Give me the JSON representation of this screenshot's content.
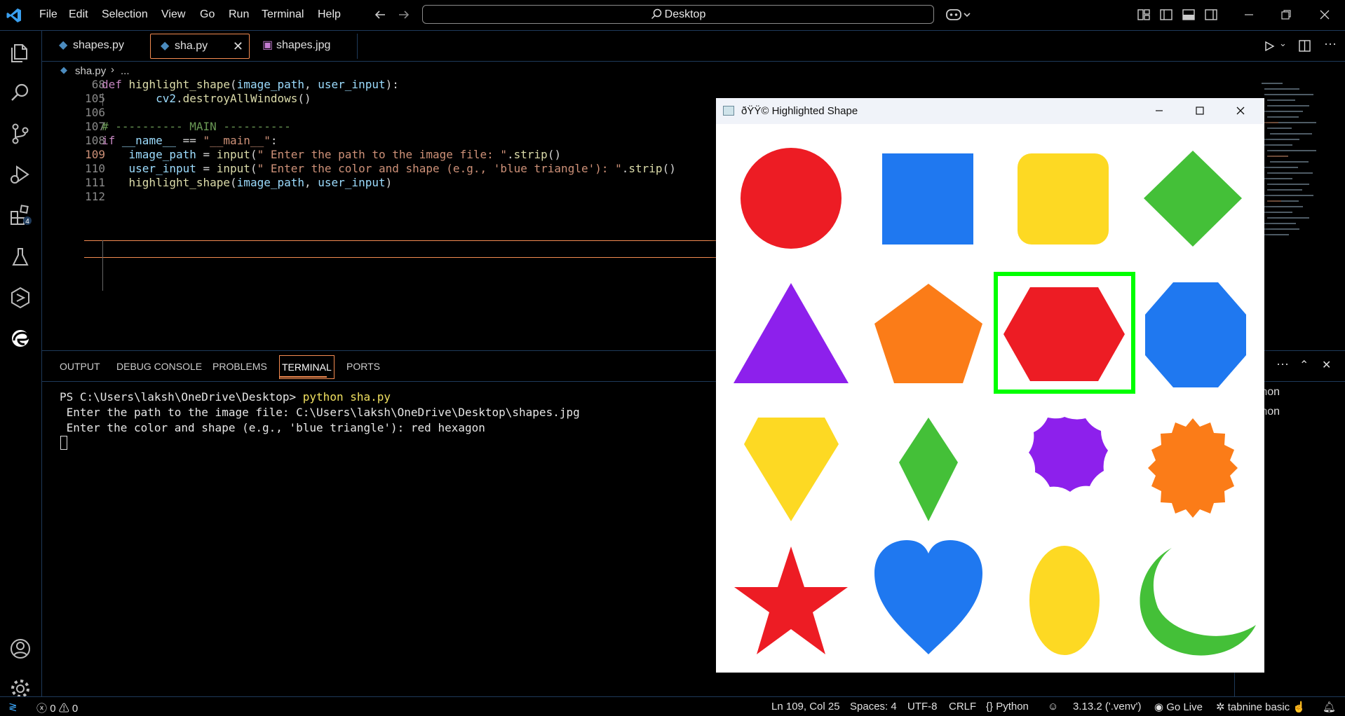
{
  "titlebar": {
    "menu": [
      "File",
      "Edit",
      "Selection",
      "View",
      "Go",
      "Run",
      "Terminal",
      "Help"
    ],
    "search_text": "Desktop"
  },
  "tabs": [
    {
      "label": "shapes.py",
      "icon": "python-file-icon"
    },
    {
      "label": "sha.py",
      "icon": "python-file-icon",
      "active": true
    },
    {
      "label": "shapes.jpg",
      "icon": "image-file-icon"
    }
  ],
  "breadcrumb": {
    "file": "sha.py",
    "rest": "..."
  },
  "editor": {
    "lines": [
      {
        "num": "68",
        "parts": [
          [
            "kw",
            "def "
          ],
          [
            "fn",
            "highlight_shape"
          ],
          [
            "pl",
            "("
          ],
          [
            "var",
            "image_path"
          ],
          [
            "pl",
            ", "
          ],
          [
            "var",
            "user_input"
          ],
          [
            "pl",
            "):"
          ]
        ]
      },
      {
        "num": "105",
        "parts": [
          [
            "pl",
            "        "
          ],
          [
            "var",
            "cv2"
          ],
          [
            "pl",
            "."
          ],
          [
            "fn",
            "destroyAllWindows"
          ],
          [
            "pl",
            "()"
          ]
        ]
      },
      {
        "num": "106",
        "parts": []
      },
      {
        "num": "107",
        "parts": [
          [
            "cm",
            "# ---------- MAIN ----------"
          ]
        ]
      },
      {
        "num": "108",
        "parts": [
          [
            "kw",
            "if "
          ],
          [
            "var",
            "__name__"
          ],
          [
            "pl",
            " == "
          ],
          [
            "str",
            "\"__main__\""
          ],
          [
            "pl",
            ":"
          ]
        ]
      },
      {
        "num": "109",
        "parts": [
          [
            "pl",
            "    "
          ],
          [
            "var",
            "image_path"
          ],
          [
            "pl",
            " = "
          ],
          [
            "fn",
            "input"
          ],
          [
            "pl",
            "("
          ],
          [
            "str",
            "\" Enter the path to the image file: \""
          ],
          [
            "pl",
            "."
          ],
          [
            "fn",
            "strip"
          ],
          [
            "pl",
            "()"
          ]
        ]
      },
      {
        "num": "110",
        "parts": [
          [
            "pl",
            "    "
          ],
          [
            "var",
            "user_input"
          ],
          [
            "pl",
            " = "
          ],
          [
            "fn",
            "input"
          ],
          [
            "pl",
            "("
          ],
          [
            "str",
            "\" Enter the color and shape (e.g., 'blue triangle'): \""
          ],
          [
            "pl",
            "."
          ],
          [
            "fn",
            "strip"
          ],
          [
            "pl",
            "()"
          ]
        ]
      },
      {
        "num": "111",
        "parts": [
          [
            "pl",
            "    "
          ],
          [
            "fn",
            "highlight_shape"
          ],
          [
            "pl",
            "("
          ],
          [
            "var",
            "image_path"
          ],
          [
            "pl",
            ", "
          ],
          [
            "var",
            "user_input"
          ],
          [
            "pl",
            ")"
          ]
        ]
      },
      {
        "num": "112",
        "parts": []
      }
    ]
  },
  "panel": {
    "tabs": [
      "OUTPUT",
      "DEBUG CONSOLE",
      "PROBLEMS",
      "TERMINAL",
      "PORTS"
    ],
    "active_tab": "TERMINAL",
    "terminal_prompt": "PS C:\\Users\\laksh\\OneDrive\\Desktop> ",
    "terminal_cmd": "python sha.py",
    "terminal_lines": [
      " Enter the path to the image file: C:\\Users\\laksh\\OneDrive\\Desktop\\shapes.jpg",
      " Enter the color and shape (e.g., 'blue triangle'): red hexagon"
    ],
    "terminal_list": [
      "python",
      "python"
    ]
  },
  "popup": {
    "title": "ðŸŸ© Highlighted Shape",
    "shapes": [
      {
        "name": "red-circle",
        "color": "#ed1c24"
      },
      {
        "name": "blue-square",
        "color": "#1f78f0"
      },
      {
        "name": "yellow-rounded-square",
        "color": "#fdd923"
      },
      {
        "name": "green-diamond",
        "color": "#44c038"
      },
      {
        "name": "purple-triangle",
        "color": "#8d20ec"
      },
      {
        "name": "orange-pentagon",
        "color": "#fb7c18"
      },
      {
        "name": "red-hexagon",
        "color": "#ed1c24",
        "highlighted": true
      },
      {
        "name": "blue-octagon",
        "color": "#1f78f0"
      },
      {
        "name": "yellow-gem",
        "color": "#fdd923"
      },
      {
        "name": "green-kite",
        "color": "#44c038"
      },
      {
        "name": "purple-scalloped-circle",
        "color": "#8d20ec"
      },
      {
        "name": "orange-badge",
        "color": "#fb7c18"
      },
      {
        "name": "red-star",
        "color": "#ed1c24"
      },
      {
        "name": "blue-heart",
        "color": "#1f78f0"
      },
      {
        "name": "yellow-oval",
        "color": "#fdd923"
      },
      {
        "name": "green-crescent",
        "color": "#44c038"
      }
    ],
    "highlight_color": "#00ff00"
  },
  "status": {
    "errors": "0",
    "warnings": "0",
    "position": "Ln 109, Col 25",
    "spaces": "Spaces: 4",
    "encoding": "UTF-8",
    "eol": "CRLF",
    "language": "Python",
    "interpreter": "3.13.2 ('.venv')",
    "golive": "Go Live",
    "tabnine": "tabnine basic"
  },
  "colors": {
    "accent": "#0078d4",
    "active_line_number": "#ce9178",
    "border": "#1e3a5a",
    "tab_active_border": "#f38b51"
  }
}
